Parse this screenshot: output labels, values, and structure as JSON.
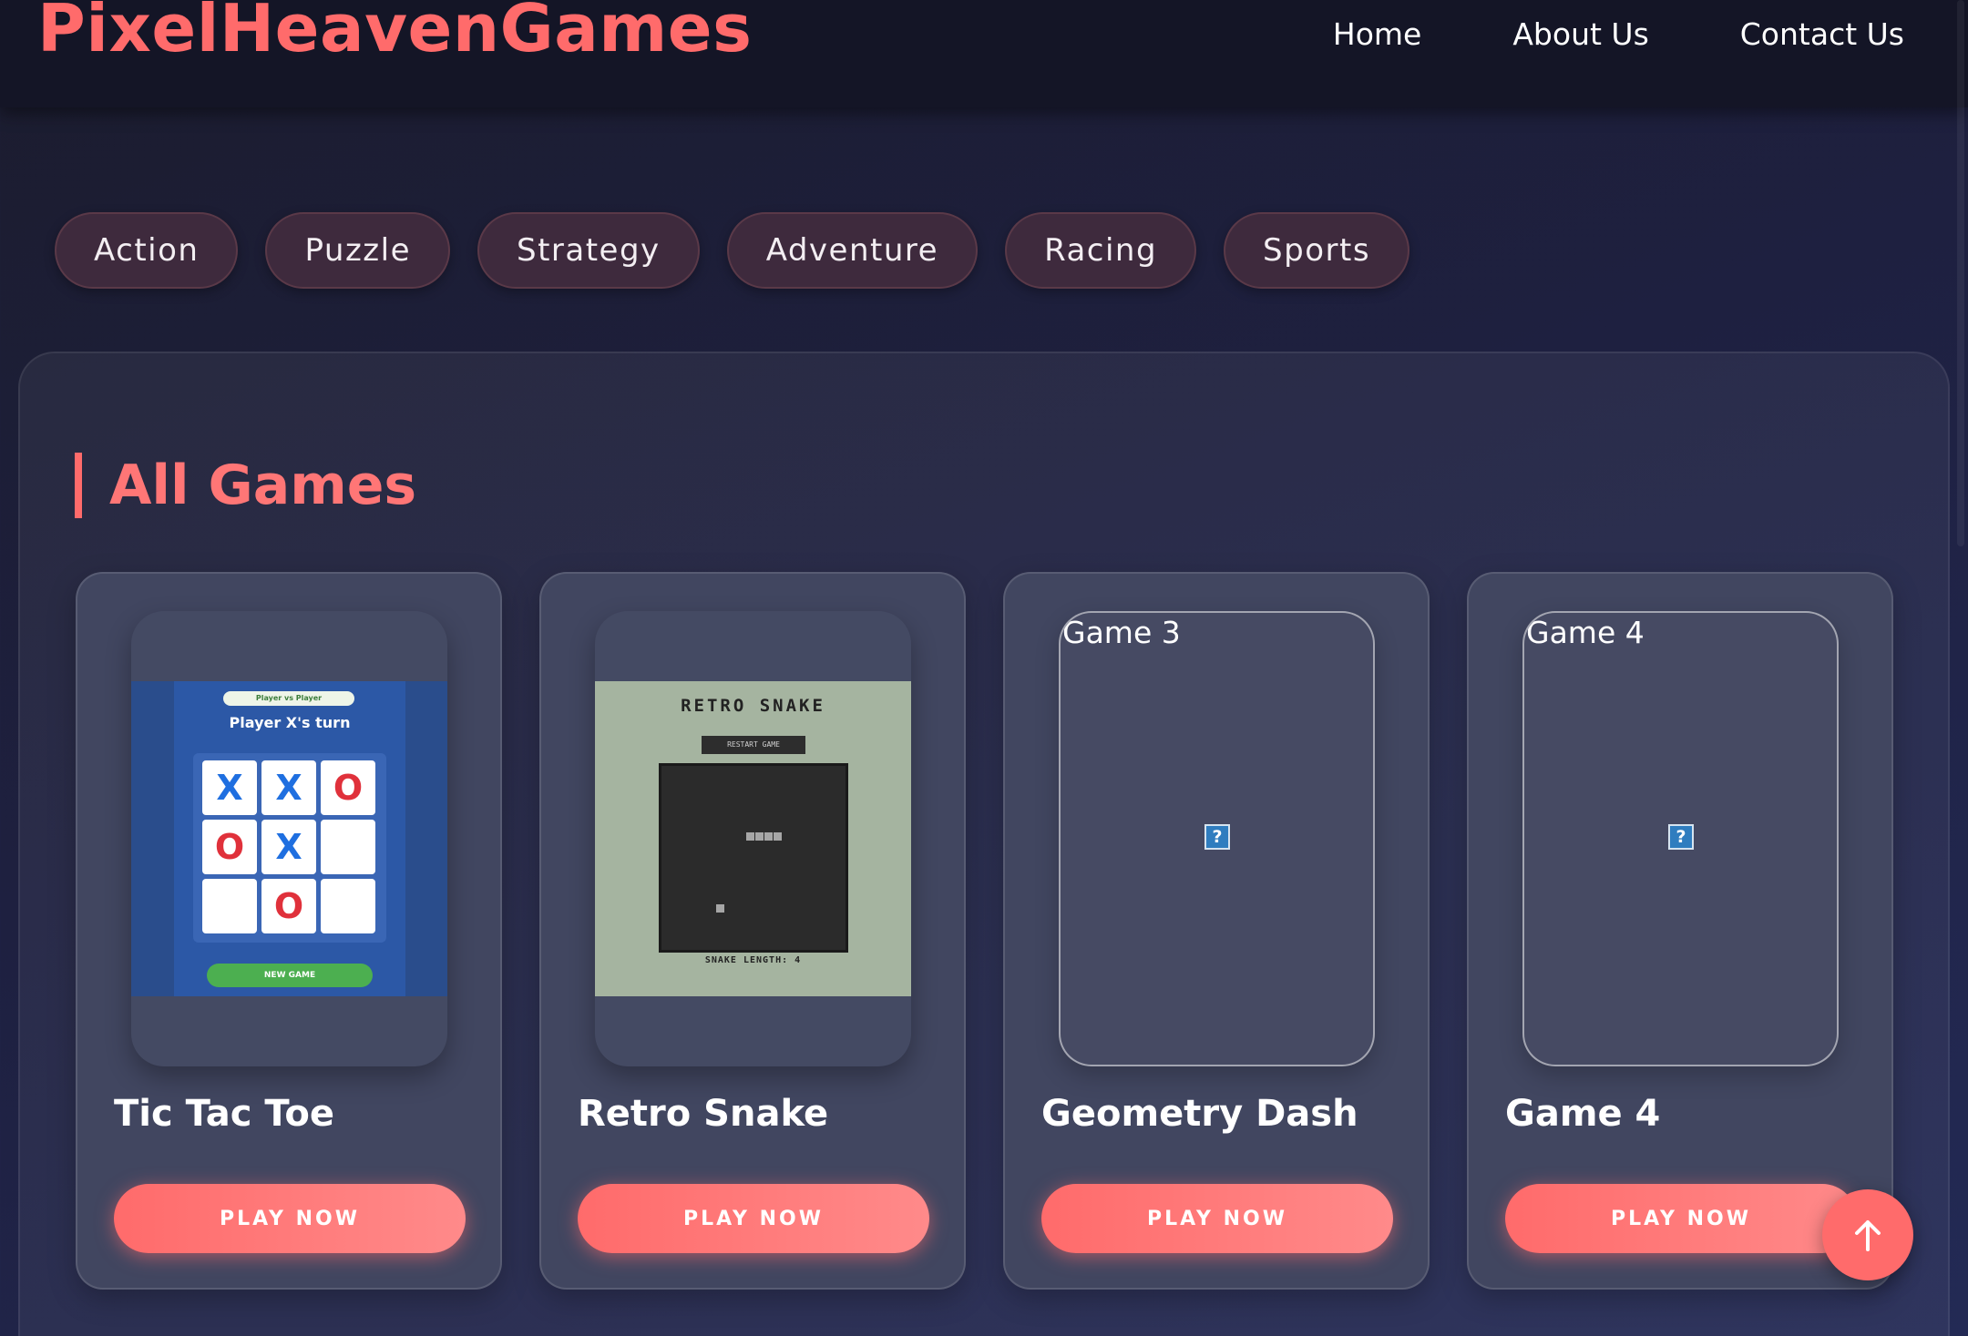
{
  "header": {
    "logo": "PixelHeavenGames",
    "nav": [
      "Home",
      "About Us",
      "Contact Us"
    ]
  },
  "categories": [
    "Action",
    "Puzzle",
    "Strategy",
    "Adventure",
    "Racing",
    "Sports"
  ],
  "section": {
    "title": "All Games"
  },
  "games": [
    {
      "title": "Tic Tac Toe",
      "play_label": "PLAY NOW",
      "thumbnail": {
        "mode": "Player vs Player",
        "turn": "Player X's turn",
        "board": [
          "X",
          "X",
          "O",
          "O",
          "X",
          "",
          "",
          "O",
          ""
        ],
        "new_game": "NEW GAME"
      }
    },
    {
      "title": "Retro Snake",
      "play_label": "PLAY NOW",
      "thumbnail": {
        "title": "RETRO SNAKE",
        "restart": "RESTART GAME",
        "length_label": "SNAKE LENGTH: 4"
      }
    },
    {
      "title": "Geometry Dash",
      "play_label": "PLAY NOW",
      "thumbnail": {
        "alt": "Game 3",
        "broken_icon": "?"
      }
    },
    {
      "title": "Game 4",
      "play_label": "PLAY NOW",
      "thumbnail": {
        "alt": "Game 4",
        "broken_icon": "?"
      }
    }
  ],
  "scroll_top": {
    "icon": "arrow-up-icon"
  },
  "colors": {
    "accent": "#ff6b6b",
    "header_bg": "#141526",
    "pill_bg": "#3e2a3d",
    "card_bg": "#414660"
  }
}
